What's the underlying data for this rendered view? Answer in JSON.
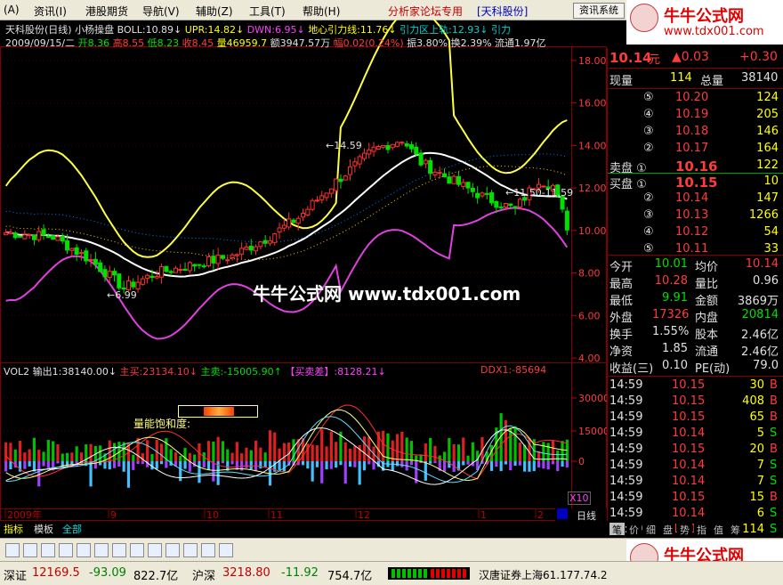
{
  "menu": {
    "items": [
      "(A)",
      "资讯(I)",
      "港股期货",
      "导航(V)",
      "辅助(Z)",
      "工具(T)",
      "帮助(H)"
    ],
    "forum": "分析家论坛专用",
    "stock": "[天科股份]",
    "system": "资讯系统"
  },
  "logo": {
    "title": "牛牛公式网",
    "url": "www.tdx001.com"
  },
  "watermark": {
    "text": "牛牛公式网 www.tdx001.com"
  },
  "header": {
    "name": "天科股份(日线)",
    "indicator": "小杨操盘 BOLL:10.89↓",
    "upr": "UPR:14.82↓",
    "dwn": "DWN:6.95↓",
    "mid": "地心引力线:11.76↓",
    "ylq": "引力区上轨:12.93↓",
    "tail": "引力",
    "ohlc": {
      "date": "2009/09/15/二",
      "open": "开8.36",
      "high": "高8.55",
      "low": "低8.23",
      "close": "收8.45",
      "vol": "量46959.7",
      "amt": "额3947.57万",
      "pct": "幅0.02(0.24%)",
      "amp": "振3.80%",
      "turn": "换2.39%",
      "float": "流通1.97亿"
    }
  },
  "vol_header": {
    "name": "VOL2",
    "out": "输出1:38140.00↓",
    "buy": "主买:23134.10↓",
    "sell": "主卖:-15005.90↑",
    "diff": "【买卖差】:8128.21↓",
    "ddx": "DDX1:-85694"
  },
  "annotations": {
    "high_label": "←14.59",
    "low_label": "←6.99",
    "right_label": "←11.50-11.59",
    "energy": "量能饱和度:",
    "x10": "X10",
    "period": "日线"
  },
  "chart_data": {
    "type": "candlestick",
    "price_axis": {
      "ticks": [
        "18.00",
        "16.00",
        "14.00",
        "12.00",
        "10.00",
        "8.00",
        "6.00",
        "4.00"
      ],
      "range": [
        4,
        18.5
      ]
    },
    "vol_axis": {
      "ticks": [
        "30000",
        "15000",
        "0"
      ]
    },
    "x_axis": {
      "labels": [
        "2009年",
        "9",
        "10",
        "11",
        "12",
        "1",
        "2"
      ]
    },
    "notable": {
      "high": 14.59,
      "low": 6.99
    }
  },
  "quote": {
    "price": "10.14",
    "unit": "元",
    "change": "▲0.03",
    "change2": "+0.30",
    "now_vol_label": "现量",
    "now_vol": "114",
    "total_vol_label": "总量",
    "total_vol": "38140",
    "asks": [
      {
        "lvl": "⑤",
        "price": "10.20",
        "vol": "124"
      },
      {
        "lvl": "④",
        "price": "10.19",
        "vol": "205"
      },
      {
        "lvl": "③",
        "price": "10.18",
        "vol": "146"
      },
      {
        "lvl": "②",
        "price": "10.17",
        "vol": "164"
      },
      {
        "lvl": "卖盘 ①",
        "price": "10.16",
        "vol": "122"
      }
    ],
    "bids": [
      {
        "lvl": "买盘 ①",
        "price": "10.15",
        "vol": "10"
      },
      {
        "lvl": "②",
        "price": "10.14",
        "vol": "147"
      },
      {
        "lvl": "③",
        "price": "10.13",
        "vol": "1266"
      },
      {
        "lvl": "④",
        "price": "10.12",
        "vol": "54"
      },
      {
        "lvl": "⑤",
        "price": "10.11",
        "vol": "33"
      }
    ],
    "stats": [
      {
        "l1": "今开",
        "v1": "10.01",
        "c1": "green",
        "l2": "均价",
        "v2": "10.14",
        "c2": "red"
      },
      {
        "l1": "最高",
        "v1": "10.28",
        "c1": "red",
        "l2": "量比",
        "v2": "0.96",
        "c2": "white"
      },
      {
        "l1": "最低",
        "v1": "9.91",
        "c1": "green",
        "l2": "金额",
        "v2": "3869万",
        "c2": "white"
      },
      {
        "l1": "外盘",
        "v1": "17326",
        "c1": "red",
        "l2": "内盘",
        "v2": "20814",
        "c2": "green"
      },
      {
        "l1": "换手",
        "v1": "1.55%",
        "c1": "white",
        "l2": "股本",
        "v2": "2.46亿",
        "c2": "white"
      },
      {
        "l1": "净资",
        "v1": "1.85",
        "c1": "white",
        "l2": "流通",
        "v2": "2.46亿",
        "c2": "white"
      },
      {
        "l1": "收益(三)",
        "v1": "0.10",
        "c1": "white",
        "l2": "PE(动)",
        "v2": "79.0",
        "c2": "white"
      }
    ],
    "ticks": [
      {
        "t": "14:59",
        "p": "10.15",
        "v": "30",
        "f": "B"
      },
      {
        "t": "14:59",
        "p": "10.15",
        "v": "408",
        "f": "B"
      },
      {
        "t": "14:59",
        "p": "10.15",
        "v": "65",
        "f": "B"
      },
      {
        "t": "14:59",
        "p": "10.14",
        "v": "5",
        "f": "S"
      },
      {
        "t": "14:59",
        "p": "10.15",
        "v": "20",
        "f": "B"
      },
      {
        "t": "14:59",
        "p": "10.14",
        "v": "7",
        "f": "S"
      },
      {
        "t": "14:59",
        "p": "10.14",
        "v": "7",
        "f": "S"
      },
      {
        "t": "14:59",
        "p": "10.15",
        "v": "15",
        "f": "B"
      },
      {
        "t": "14:59",
        "p": "10.14",
        "v": "6",
        "f": "S"
      },
      {
        "t": "15:00",
        "p": "10.15",
        "v": "114",
        "f": "S"
      }
    ],
    "tabs": [
      "笔",
      "价",
      "细",
      "盘",
      "势",
      "指",
      "值",
      "筹"
    ]
  },
  "bottom_tabs": [
    "指标",
    "模板",
    "全部"
  ],
  "status": {
    "sz_name": "深证",
    "sz_index": "12169.5",
    "sz_chg": "-93.09",
    "sz_amt": "822.7亿",
    "hs_name": "沪深",
    "hs_index": "3218.80",
    "hs_chg": "-11.92",
    "hs_amt": "754.7亿",
    "broker": "汉唐证券上海61.177.74.2"
  }
}
